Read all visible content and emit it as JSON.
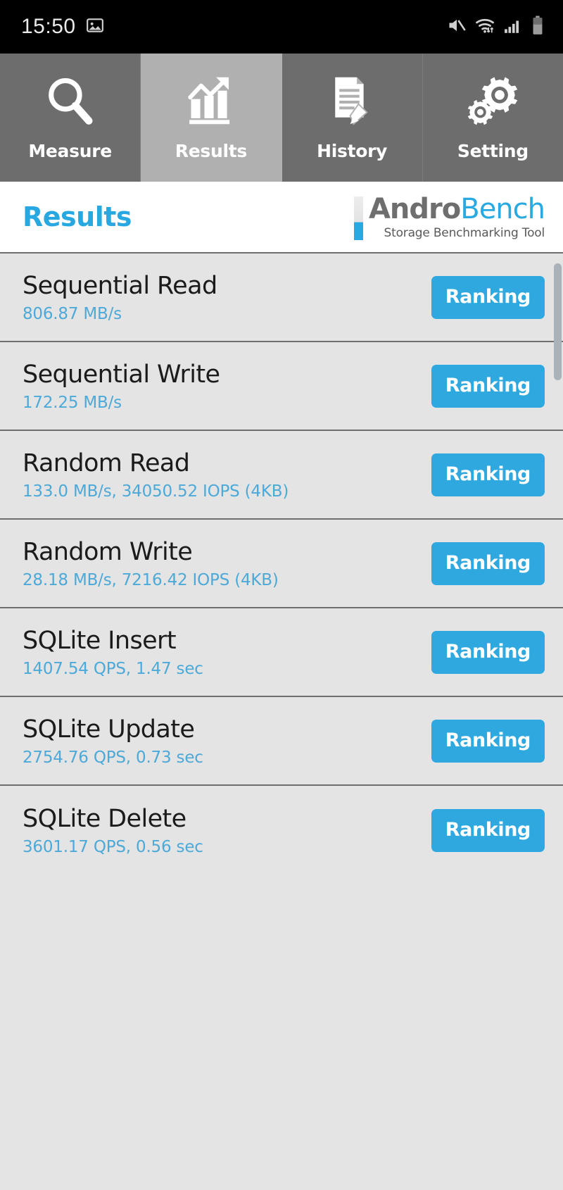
{
  "statusbar": {
    "time": "15:50",
    "icons": [
      "image-icon",
      "mute-icon",
      "wifi-icon",
      "signal-icon",
      "battery-icon"
    ]
  },
  "tabs": [
    {
      "label": "Measure",
      "icon": "magnifier-icon",
      "active": false
    },
    {
      "label": "Results",
      "icon": "bar-chart-arrow-icon",
      "active": true
    },
    {
      "label": "History",
      "icon": "document-pencil-icon",
      "active": false
    },
    {
      "label": "Setting",
      "icon": "gears-icon",
      "active": false
    }
  ],
  "header": {
    "title": "Results",
    "logo_primary": "Andro",
    "logo_secondary": "Bench",
    "logo_tagline": "Storage Benchmarking Tool"
  },
  "colors": {
    "accent_blue": "#29a9e1",
    "button_blue": "#2fa8e0",
    "value_blue": "#4ca9d8",
    "tab_inactive": "#6d6d6d",
    "tab_active": "#b0b0b0",
    "list_bg": "#e4e4e4"
  },
  "results": {
    "button_label": "Ranking",
    "rows": [
      {
        "name": "Sequential Read",
        "value": "806.87 MB/s"
      },
      {
        "name": "Sequential Write",
        "value": "172.25 MB/s"
      },
      {
        "name": "Random Read",
        "value": "133.0 MB/s, 34050.52 IOPS (4KB)"
      },
      {
        "name": "Random Write",
        "value": "28.18 MB/s, 7216.42 IOPS (4KB)"
      },
      {
        "name": "SQLite Insert",
        "value": "1407.54 QPS, 1.47 sec"
      },
      {
        "name": "SQLite Update",
        "value": "2754.76 QPS, 0.73 sec"
      },
      {
        "name": "SQLite Delete",
        "value": "3601.17 QPS, 0.56 sec"
      }
    ]
  }
}
